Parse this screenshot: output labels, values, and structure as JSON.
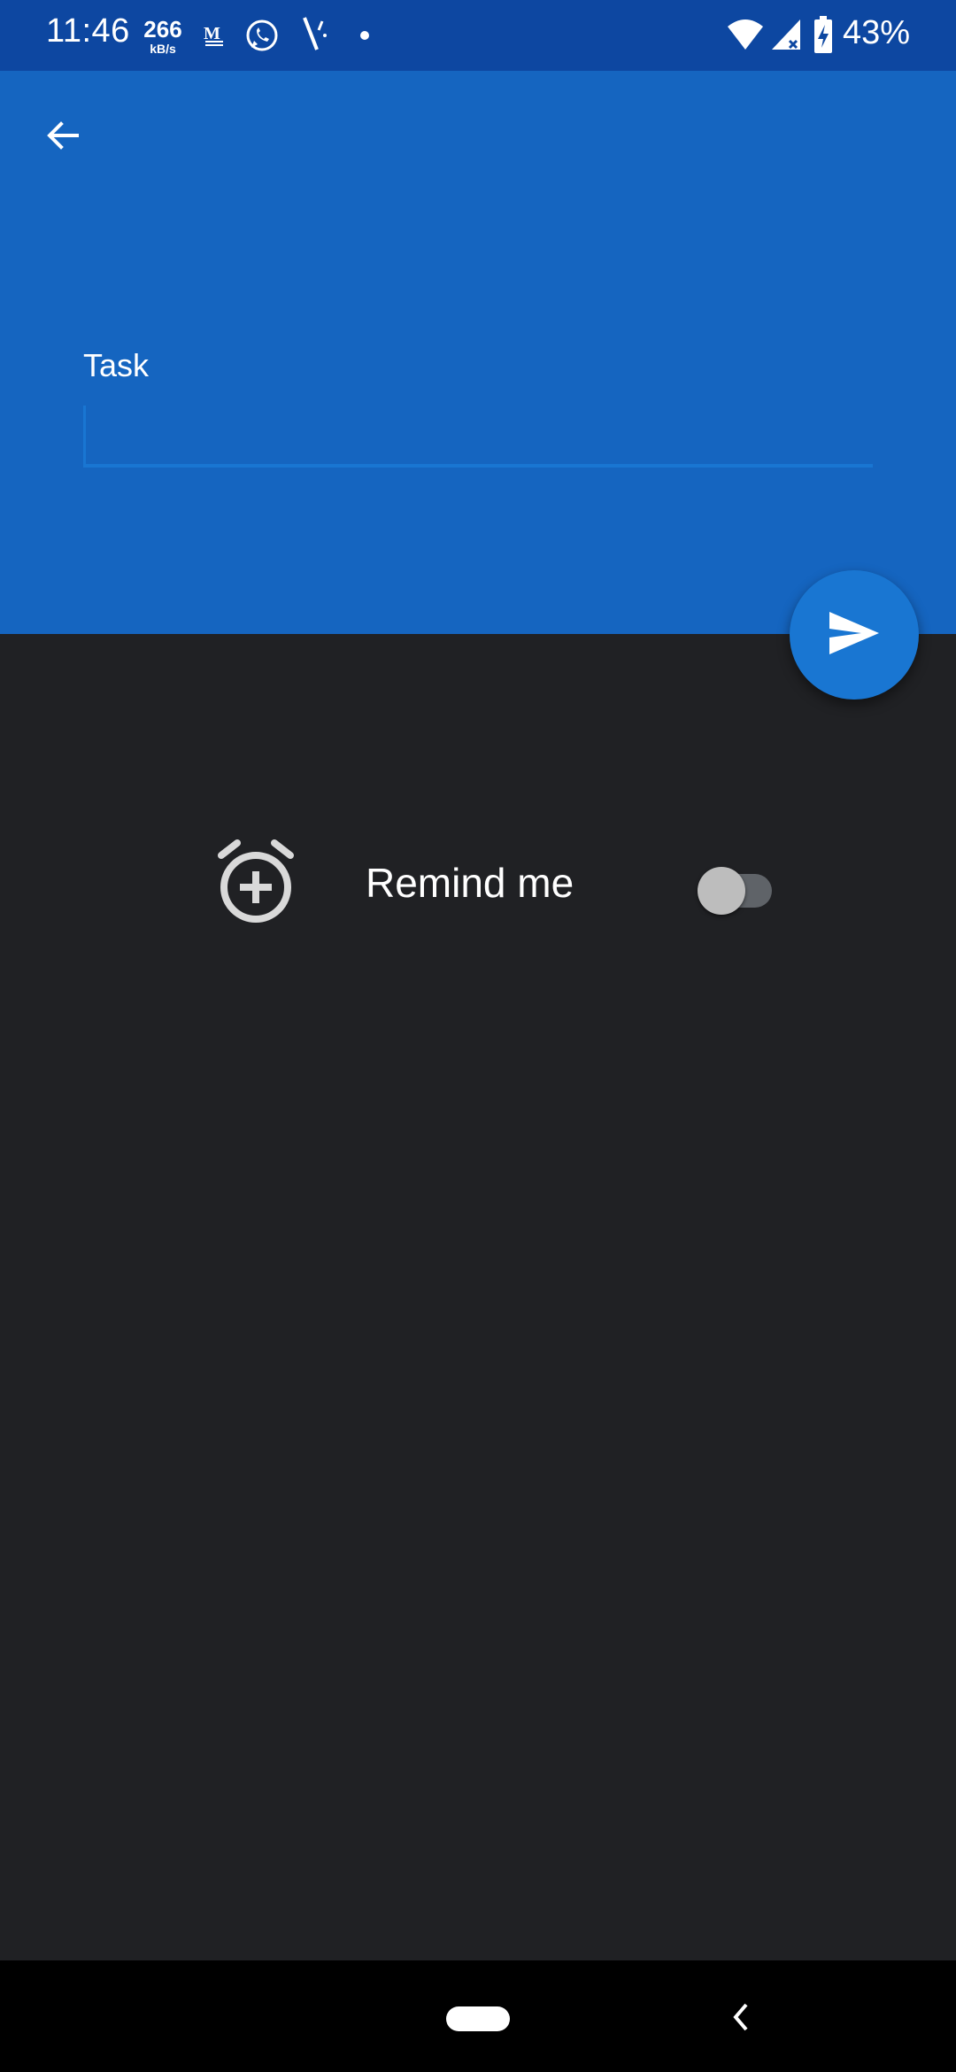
{
  "status_bar": {
    "time": "11:46",
    "net_speed_value": "266",
    "net_speed_unit": "kB/s",
    "notification_icons": [
      "gmail-icon",
      "whatsapp-icon",
      "app-icon",
      "dot-icon"
    ],
    "wifi": "wifi-icon",
    "signal": "cell-signal-icon",
    "battery_icon": "battery-charging-icon",
    "battery_percent": "43%"
  },
  "header": {
    "back_icon": "arrow-back-icon",
    "task_label": "Task",
    "task_value": "",
    "background_color": "#1565c0",
    "accent_color": "#1976d2"
  },
  "fab": {
    "icon": "send-icon"
  },
  "reminder": {
    "icon": "alarm-add-icon",
    "label": "Remind me",
    "enabled": false
  },
  "nav_bar": {
    "home": "home-pill",
    "back": "nav-back-icon"
  }
}
